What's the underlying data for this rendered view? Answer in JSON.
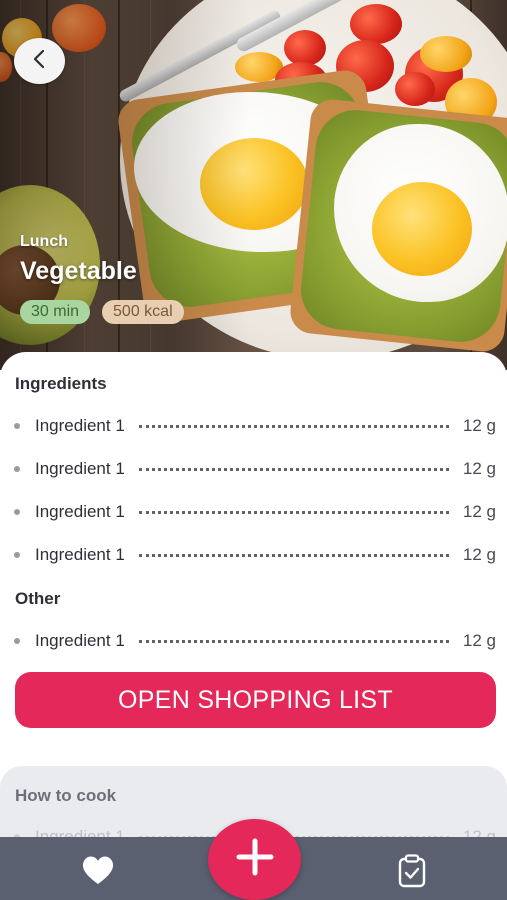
{
  "hero": {
    "category": "Lunch",
    "dish_name": "Vegetable",
    "time_badge": "30 min",
    "kcal_badge": "500 kcal",
    "back_icon": "chevron-left-icon"
  },
  "ingredients": {
    "title": "Ingredients",
    "items": [
      {
        "name": "Ingredient 1",
        "qty": "12 g"
      },
      {
        "name": "Ingredient 1",
        "qty": "12 g"
      },
      {
        "name": "Ingredient 1",
        "qty": "12 g"
      },
      {
        "name": "Ingredient 1",
        "qty": "12 g"
      }
    ]
  },
  "other": {
    "title": "Other",
    "items": [
      {
        "name": "Ingredient 1",
        "qty": "12 g"
      }
    ]
  },
  "shopping_button": "OPEN SHOPPING LIST",
  "how_to_cook": {
    "title": "How to cook",
    "peek_item": {
      "name": "Ingredient 1",
      "qty": "12 g"
    }
  },
  "nav": {
    "favorites_icon": "heart-icon",
    "add_icon": "plus-icon",
    "list_icon": "clipboard-check-icon"
  },
  "colors": {
    "accent": "#e4285a",
    "nav_bg": "#5a6070",
    "time_badge_bg": "#a9d6a0",
    "kcal_badge_bg": "#e8cfb1"
  }
}
